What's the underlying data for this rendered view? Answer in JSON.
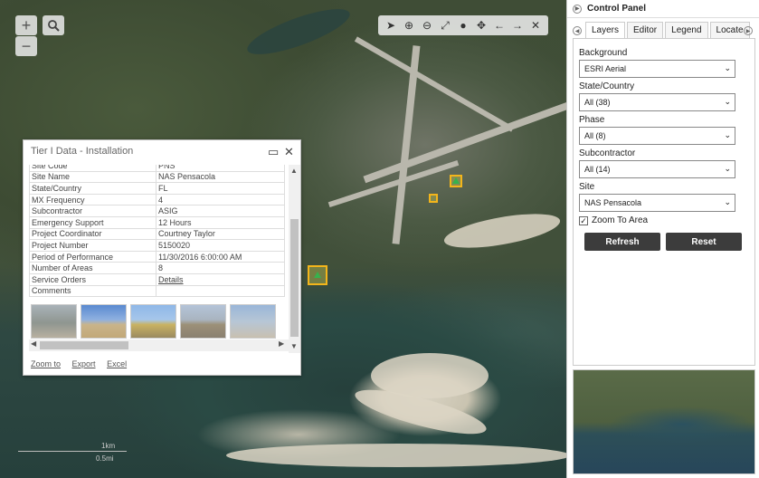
{
  "map": {
    "zoom_in": "+",
    "zoom_out": "−",
    "scale_km": "1km",
    "scale_mi": "0.5mi"
  },
  "toolbar": {
    "icons": [
      "select-icon",
      "zoom-in-icon",
      "zoom-out-icon",
      "full-extent-icon",
      "globe-icon",
      "pan-icon",
      "back-icon",
      "forward-icon",
      "close-icon"
    ]
  },
  "popup": {
    "title": "Tier I Data - Installation",
    "rows": [
      {
        "k": "Site Code",
        "v": "PNS"
      },
      {
        "k": "Site Name",
        "v": "NAS Pensacola"
      },
      {
        "k": "State/Country",
        "v": "FL"
      },
      {
        "k": "MX Frequency",
        "v": "4"
      },
      {
        "k": "Subcontractor",
        "v": "ASIG"
      },
      {
        "k": "Emergency Support",
        "v": "12 Hours"
      },
      {
        "k": "Project Coordinator",
        "v": "Courtney Taylor"
      },
      {
        "k": "Project Number",
        "v": "5150020"
      },
      {
        "k": "Period of Performance",
        "v": "11/30/2016 6:00:00 AM"
      },
      {
        "k": "Number of Areas",
        "v": "8"
      },
      {
        "k": "Service Orders",
        "v": "Details"
      },
      {
        "k": "Comments",
        "v": ""
      }
    ],
    "links": {
      "zoom": "Zoom to",
      "export": "Export",
      "excel": "Excel"
    }
  },
  "panel": {
    "title": "Control Panel",
    "tabs": [
      "Layers",
      "Editor",
      "Legend",
      "Locate"
    ],
    "background_label": "Background",
    "background_value": "ESRI Aerial",
    "state_label": "State/Country",
    "state_value": "All (38)",
    "phase_label": "Phase",
    "phase_value": "All (8)",
    "sub_label": "Subcontractor",
    "sub_value": "All (14)",
    "site_label": "Site",
    "site_value": "NAS Pensacola",
    "zoom_area": "Zoom To Area",
    "refresh": "Refresh",
    "reset": "Reset"
  }
}
